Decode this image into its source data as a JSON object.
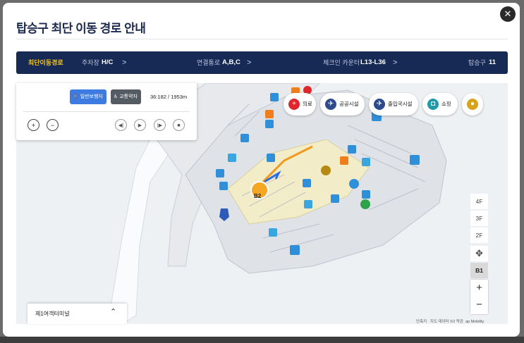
{
  "modal": {
    "title": "탑승구 최단 이동 경로 안내",
    "close_label": "✕"
  },
  "route": {
    "active_label": "최단이동경로",
    "steps": [
      {
        "label": "주차장",
        "value": "H/C"
      },
      {
        "label": "연결통로",
        "value": "A,B,C"
      },
      {
        "label": "체크인 카운터",
        "value": "L13-L36"
      },
      {
        "label": "탑승구",
        "value": "11"
      }
    ]
  },
  "panel": {
    "walk_label": "일반보행자",
    "mobility_label": "교통약자",
    "distance": "36:182 / 1953m",
    "zoom_in": "+",
    "zoom_out": "−",
    "prev": "◀|",
    "play": "▶",
    "next": "|▶",
    "stop": "■"
  },
  "categories": [
    {
      "label": "의료",
      "icon": "medical-icon",
      "color": "#e0262c"
    },
    {
      "label": "공공시설",
      "icon": "airplane-icon",
      "color": "#2d4a8c"
    },
    {
      "label": "출입국시설",
      "icon": "airplane-icon",
      "color": "#2d4a8c"
    },
    {
      "label": "쇼핑",
      "icon": "shopping-icon",
      "color": "#1f9aa8"
    }
  ],
  "floors": [
    "4F",
    "3F",
    "2F",
    "B1"
  ],
  "selected_floor": "B1",
  "zoom": {
    "in": "+",
    "out": "−"
  },
  "map_marker": "B2",
  "attribution": {
    "shortcut": "단축키",
    "data": "지도 데이터 ©2 약관",
    "provider": "ap Mobility"
  },
  "terminal": {
    "label": "제1여객터미널"
  }
}
